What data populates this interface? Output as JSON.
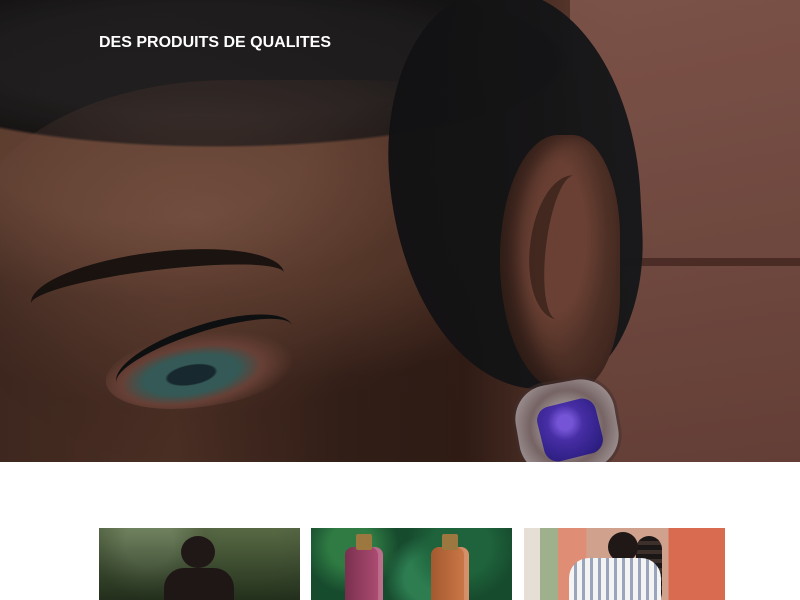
{
  "hero": {
    "title": "DES PRODUITS DE QUALITES",
    "image": "woman-ear-closeup-with-purple-earring"
  },
  "products": [
    {
      "image": "woman-in-garden"
    },
    {
      "image": "two-oil-bottles-with-leaves"
    },
    {
      "image": "woman-in-striped-shirt-with-braids"
    }
  ],
  "colors": {
    "hero_text": "#ffffff",
    "earring": "#5537c5",
    "background": "#ffffff"
  }
}
